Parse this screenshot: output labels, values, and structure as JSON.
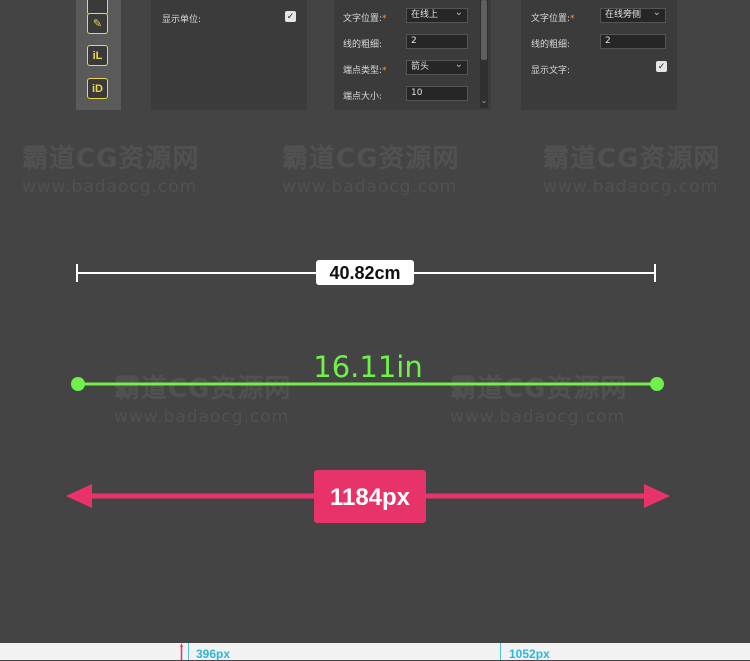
{
  "toolbar": {
    "icons": [
      "ruler-icon",
      "pen-icon",
      "info-l-icon",
      "info-d-icon"
    ],
    "glyphs": [
      "",
      "✎",
      "iL",
      "iD"
    ]
  },
  "panel1": {
    "show_unit_label": "显示单位:",
    "show_unit_checked": true
  },
  "panel2": {
    "text_position_label": "文字位置:",
    "text_position_value": "在线上",
    "line_width_label": "线的粗细:",
    "line_width_value": "2",
    "endpoint_type_label": "端点类型:",
    "endpoint_type_value": "箭头",
    "endpoint_size_label": "端点大小:",
    "endpoint_size_value": "10",
    "required_mark": "*"
  },
  "panel3": {
    "text_position_label": "文字位置:",
    "text_position_value": "在线旁侧",
    "line_width_label": "线的粗细:",
    "line_width_value": "2",
    "show_text_label": "显示文字:",
    "show_text_checked": true,
    "required_mark": "*"
  },
  "watermark": {
    "main": "霸道CG资源网",
    "url": "www.badaocg.com"
  },
  "measures": {
    "cm_label": "40.82cm",
    "in_label": "16.11in",
    "px_label": "1184px",
    "colors": {
      "cm_line": "#ffffff",
      "in_line": "#6ff04a",
      "px_line": "#e8336a"
    }
  },
  "bottom": {
    "left_value": "396px",
    "right_value": "1052px"
  }
}
